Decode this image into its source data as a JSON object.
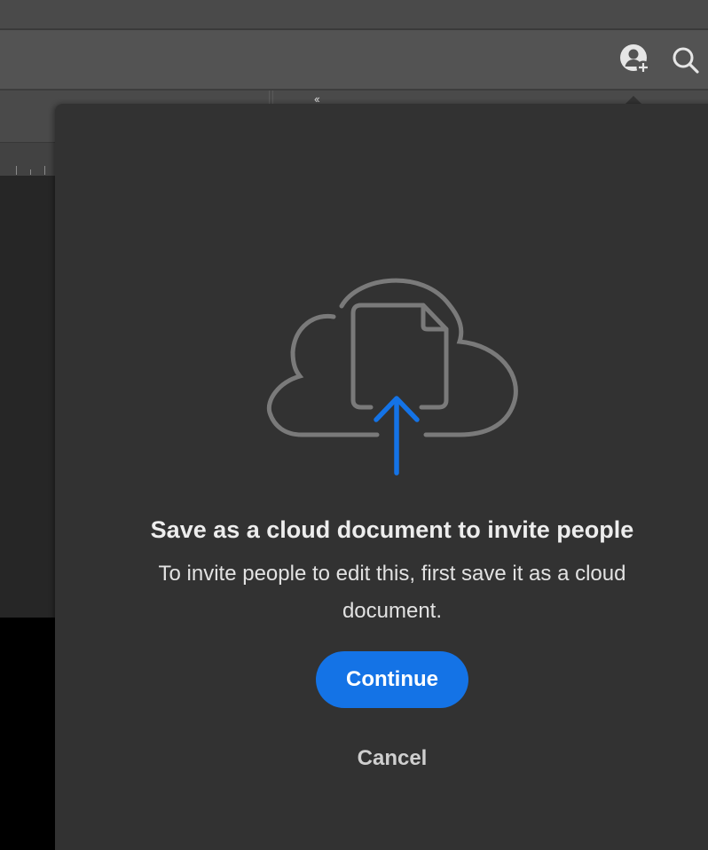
{
  "toolbar": {
    "icons": [
      "invite-people-icon",
      "search-icon"
    ],
    "collapse_label": "‹‹"
  },
  "dialog": {
    "illustration_icon": "cloud-upload-document-icon",
    "title": "Save as a cloud document to invite people",
    "description": "To invite people to edit this, first save it as a cloud document.",
    "primary_button": "Continue",
    "secondary_button": "Cancel"
  },
  "colors": {
    "accent": "#1473e6",
    "popover_bg": "#323232",
    "toolbar_bg": "#535353",
    "illustration_stroke": "#7a7a7a"
  }
}
